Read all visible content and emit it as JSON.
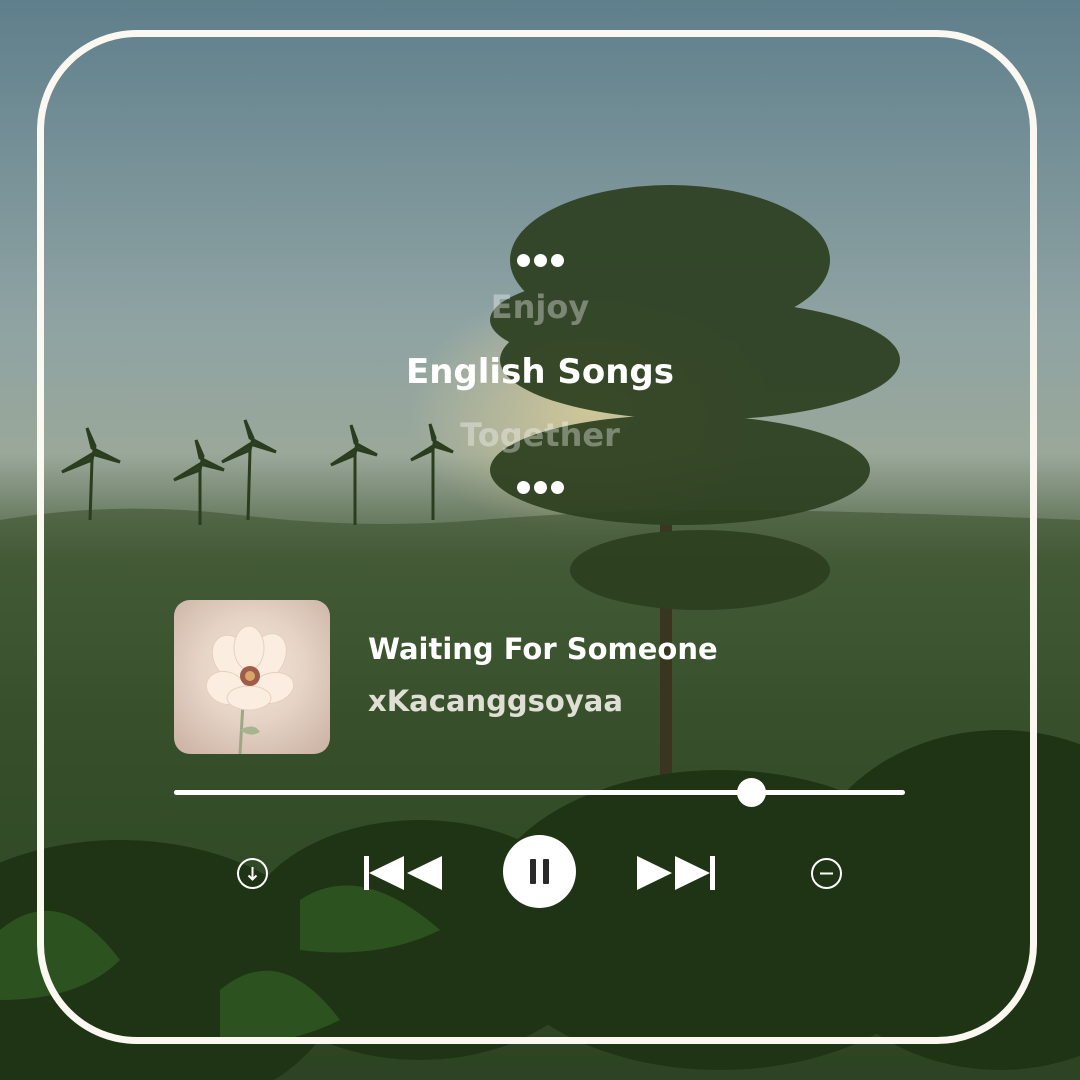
{
  "lyrics": {
    "previous": "Enjoy",
    "current": "English Songs",
    "next": "Together"
  },
  "now_playing": {
    "title": "Waiting For Someone",
    "artist": "xKacanggsoyaa",
    "progress": 0.79
  },
  "controls": {
    "download_icon": "download-icon",
    "previous_icon": "skip-previous-icon",
    "play_pause_icon": "pause-icon",
    "next_icon": "skip-next-icon",
    "remove_icon": "minus-circle-icon"
  },
  "colors": {
    "frame": "#fbf8f1",
    "text": "#ffffff"
  }
}
